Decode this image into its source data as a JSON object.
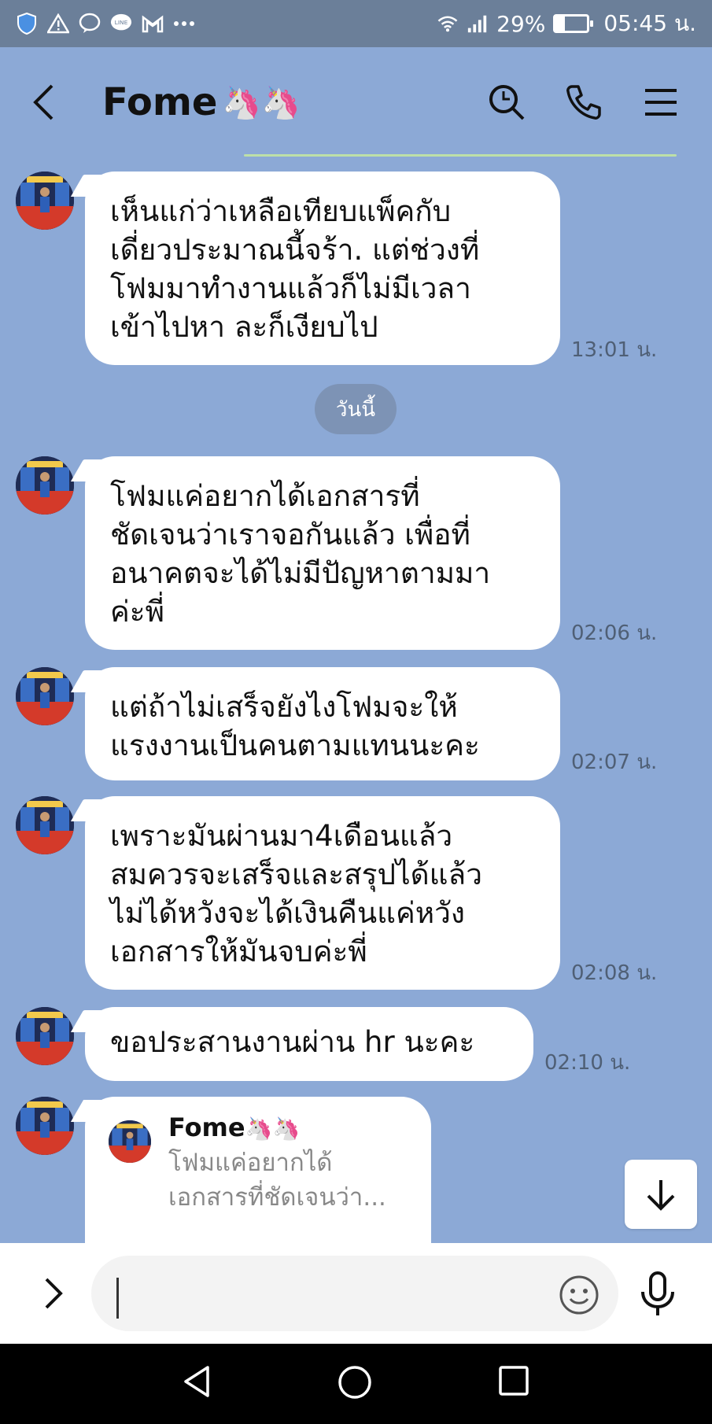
{
  "status_bar": {
    "battery": "29%",
    "battery_level": 0.29,
    "time": "05:45 น."
  },
  "header": {
    "contact_name": "Fome",
    "contact_emoji": "🦄🦄"
  },
  "date_divider": "วันนี้",
  "messages": [
    {
      "text": "เห็นแก่ว่าเหลือเทียบแพ็คกับ\nเดี่ยวประมาณนี้จร้า. แต่ช่วงที่\nโฟมมาทำงานแล้วก็ไม่มีเวลา\nเข้าไปหา ละก็เงียบไป",
      "time": "13:01 น."
    },
    {
      "text": "โฟมแค่อยากได้เอกสารที่\nชัดเจนว่าเราจอกันแล้ว เพื่อที่\nอนาคตจะได้ไม่มีปัญหาตามมา\nค่ะพี่",
      "time": "02:06 น."
    },
    {
      "text": "แต่ถ้าไม่เสร็จยังไงโฟมจะให้\nแรงงานเป็นคนตามแทนนะคะ",
      "time": "02:07 น."
    },
    {
      "text": "เพราะมันผ่านมา4เดือนแล้ว\nสมควรจะเสร็จและสรุปได้แล้ว\nไม่ได้หวังจะได้เงินคืนแค่หวัง\nเอกสารให้มันจบค่ะพี่",
      "time": "02:08 น."
    },
    {
      "text": "ขอประสานงานผ่าน hr นะคะ",
      "time": "02:10 น."
    }
  ],
  "reply_card": {
    "name": "Fome",
    "emoji": "🦄🦄",
    "preview": "โฟมแค่อยากได้\nเอกสารที่ชัดเจนว่า..."
  },
  "icons": {
    "back": "back-arrow-icon",
    "search": "search-icon",
    "call": "phone-icon",
    "menu": "hamburger-menu-icon",
    "scroll_down": "arrow-down-icon",
    "expand": "chevron-right-icon",
    "emoji": "smiley-icon",
    "mic": "microphone-icon"
  },
  "colors": {
    "chat_background": "#8ca9d6",
    "bubble": "#ffffff",
    "date_pill": "#7d93b5"
  }
}
